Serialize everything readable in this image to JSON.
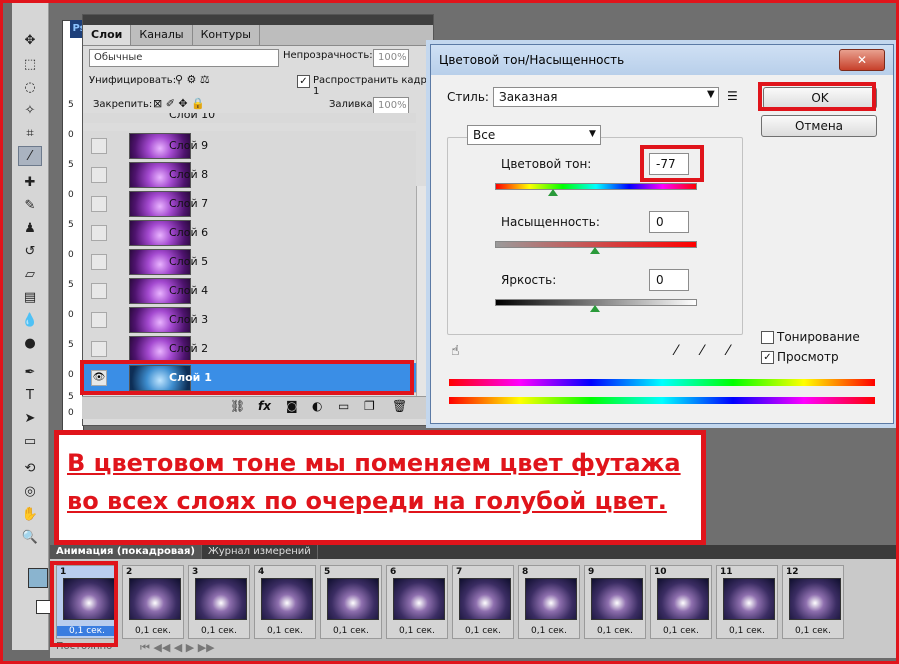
{
  "layers_panel": {
    "tabs": [
      "Слои",
      "Каналы",
      "Контуры"
    ],
    "blend_mode": "Обычные",
    "opacity_label": "Непрозрачность:",
    "opacity_value": "100%",
    "unify_label": "Унифицировать:",
    "propagate_label": "Распространить кадр 1",
    "lock_label": "Закрепить:",
    "fill_label": "Заливка:",
    "fill_value": "100%",
    "partial_top_layer": "Слой 10",
    "layers": [
      "Слой 9",
      "Слой 8",
      "Слой 7",
      "Слой 6",
      "Слой 5",
      "Слой 4",
      "Слой 3",
      "Слой 2"
    ],
    "active_layer": "Слой 1",
    "bottom_icons": [
      "link-icon",
      "fx-icon",
      "mask-icon",
      "adjustment-icon",
      "folder-icon",
      "new-layer-icon",
      "trash-icon"
    ]
  },
  "ruler_numbers": [
    "5",
    "0",
    "5",
    "0",
    "5",
    "0",
    "5",
    "0",
    "5",
    "0",
    "5",
    "0"
  ],
  "doc_tab": "Ps",
  "hue_dialog": {
    "title": "Цветовой тон/Насыщенность",
    "style_label": "Стиль:",
    "style_value": "Заказная",
    "channel_value": "Все",
    "hue_label": "Цветовой тон:",
    "hue_value": "-77",
    "hue_level": 0.29,
    "saturation_label": "Насыщенность:",
    "saturation_value": "0",
    "saturation_level": 0.5,
    "lightness_label": "Яркость:",
    "lightness_value": "0",
    "lightness_level": 0.5,
    "ok_label": "OK",
    "cancel_label": "Отмена",
    "colorize_label": "Тонирование",
    "colorize_checked": false,
    "preview_label": "Просмотр",
    "preview_checked": true
  },
  "annotation": {
    "line1": "В цветовом тоне мы поменяем цвет футажа",
    "line2": "во всех слоях по очереди на голубой цвет."
  },
  "animation_panel": {
    "tabs": [
      "Анимация (покадровая)",
      "Журнал измерений"
    ],
    "frames": [
      {
        "num": "1",
        "duration": "0,1 сек."
      },
      {
        "num": "2",
        "duration": "0,1 сек."
      },
      {
        "num": "3",
        "duration": "0,1 сек."
      },
      {
        "num": "4",
        "duration": "0,1 сек."
      },
      {
        "num": "5",
        "duration": "0,1 сек."
      },
      {
        "num": "6",
        "duration": "0,1 сек."
      },
      {
        "num": "7",
        "duration": "0,1 сек."
      },
      {
        "num": "8",
        "duration": "0,1 сек."
      },
      {
        "num": "9",
        "duration": "0,1 сек."
      },
      {
        "num": "10",
        "duration": "0,1 сек."
      },
      {
        "num": "11",
        "duration": "0,1 сек."
      },
      {
        "num": "12",
        "duration": "0,1 сек."
      }
    ],
    "loop_label": "Постоянно"
  },
  "colors": {
    "highlight_red": "#e0141b",
    "active_layer_blue": "#3a8ee6"
  }
}
